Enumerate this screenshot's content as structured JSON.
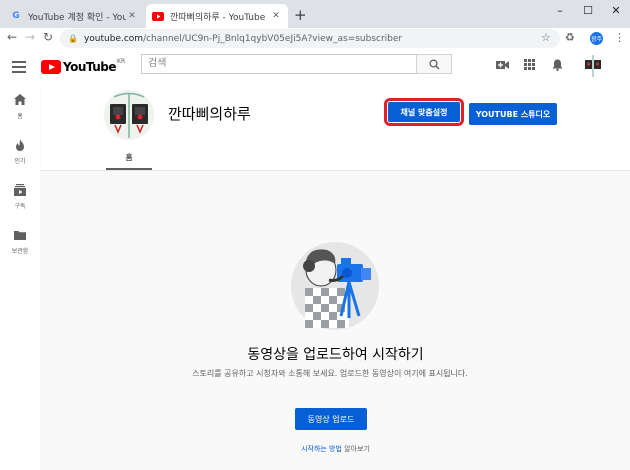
{
  "browser": {
    "tabs": [
      {
        "title": "YouTube 계정 확인 - YouTube 고",
        "favicon": "google-g-icon",
        "active": false
      },
      {
        "title": "깐따삐의하루 - YouTube",
        "favicon": "youtube-icon",
        "active": true
      }
    ],
    "url_host": "youtube.com",
    "url_path": "/channel/UC9n-Pj_Bnlq1qybV05eJi5A?view_as=subscriber",
    "profile_label": "광주"
  },
  "youtube": {
    "logo_text": "YouTube",
    "logo_region": "KR",
    "search_placeholder": "검색"
  },
  "sidebar": {
    "items": [
      {
        "icon": "home-icon",
        "label": "홈"
      },
      {
        "icon": "fire-icon",
        "label": "인기"
      },
      {
        "icon": "subscriptions-icon",
        "label": "구독"
      },
      {
        "icon": "folder-icon",
        "label": "보관함"
      }
    ]
  },
  "channel": {
    "name": "깐따삐의하루",
    "customize_button": "채널 맞춤설정",
    "studio_button": "YOUTUBE 스튜디오",
    "tab_home": "홈"
  },
  "empty_state": {
    "title": "동영상을 업로드하여 시작하기",
    "description": "스토리를 공유하고 시청자와 소통해 보세요. 업로드한 동영상이 여기에 표시됩니다.",
    "upload_button": "동영상 업로드",
    "learn_link": "시작하는 방법",
    "learn_rest": " 알아보기"
  },
  "colors": {
    "brand_red": "#ff0000",
    "accent_blue": "#065fd4",
    "highlight_red": "#e0202a"
  }
}
